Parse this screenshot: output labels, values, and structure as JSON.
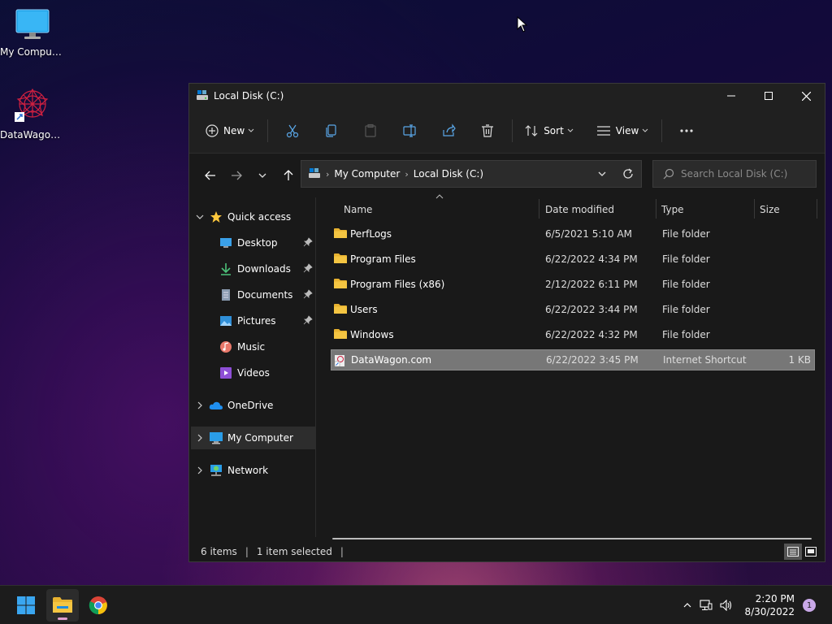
{
  "desktop": {
    "icons": [
      {
        "label": "My Computer",
        "icon": "monitor-icon"
      },
      {
        "label": "DataWagon...",
        "icon": "datawagon-shortcut-icon"
      }
    ]
  },
  "window": {
    "title": "Local Disk (C:)",
    "toolbar": {
      "new_label": "New",
      "sort_label": "Sort",
      "view_label": "View"
    },
    "address": {
      "crumbs": [
        "My Computer",
        "Local Disk (C:)"
      ]
    },
    "search": {
      "placeholder": "Search Local Disk (C:)"
    },
    "sidebar": {
      "quick_access": "Quick access",
      "items": [
        {
          "label": "Desktop",
          "icon": "desktop-icon",
          "pinned": true
        },
        {
          "label": "Downloads",
          "icon": "download-icon",
          "pinned": true
        },
        {
          "label": "Documents",
          "icon": "document-icon",
          "pinned": true
        },
        {
          "label": "Pictures",
          "icon": "pictures-icon",
          "pinned": true
        },
        {
          "label": "Music",
          "icon": "music-icon",
          "pinned": false
        },
        {
          "label": "Videos",
          "icon": "videos-icon",
          "pinned": false
        }
      ],
      "onedrive": "OneDrive",
      "my_computer": "My Computer",
      "network": "Network"
    },
    "columns": {
      "name": "Name",
      "date": "Date modified",
      "type": "Type",
      "size": "Size"
    },
    "files": [
      {
        "name": "PerfLogs",
        "date": "6/5/2021 5:10 AM",
        "type": "File folder",
        "size": ""
      },
      {
        "name": "Program Files",
        "date": "6/22/2022 4:34 PM",
        "type": "File folder",
        "size": ""
      },
      {
        "name": "Program Files (x86)",
        "date": "2/12/2022 6:11 PM",
        "type": "File folder",
        "size": ""
      },
      {
        "name": "Users",
        "date": "6/22/2022 3:44 PM",
        "type": "File folder",
        "size": ""
      },
      {
        "name": "Windows",
        "date": "6/22/2022 4:32 PM",
        "type": "File folder",
        "size": ""
      },
      {
        "name": "DataWagon.com",
        "date": "6/22/2022 3:45 PM",
        "type": "Internet Shortcut",
        "size": "1 KB"
      }
    ],
    "status": {
      "count": "6 items",
      "selected": "1 item selected"
    }
  },
  "taskbar": {
    "time": "2:20 PM",
    "date": "8/30/2022",
    "notifications": "1"
  },
  "colors": {
    "accent": "#ffc83d",
    "folder": "#f4c542",
    "selection": "#777777"
  }
}
